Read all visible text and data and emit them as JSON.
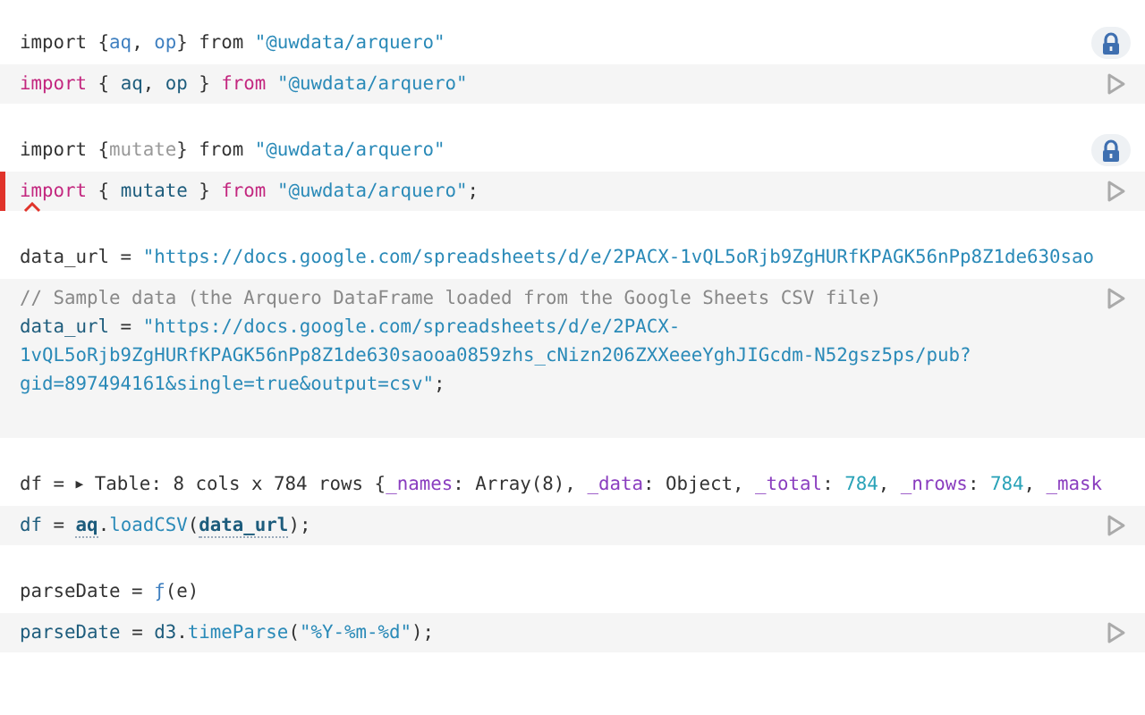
{
  "cells": [
    {
      "locked": true,
      "output": [
        {
          "text": "import {",
          "kind": "plain"
        },
        {
          "text": "aq",
          "kind": "name"
        },
        {
          "text": ", ",
          "kind": "plain"
        },
        {
          "text": "op",
          "kind": "name"
        },
        {
          "text": "} from ",
          "kind": "plain"
        },
        {
          "text": "\"@uwdata/arquero\"",
          "kind": "string"
        }
      ],
      "editor": {
        "error": false,
        "lines": [
          [
            {
              "text": "import",
              "kind": "keyword"
            },
            {
              "text": " { ",
              "kind": "plain"
            },
            {
              "text": "aq",
              "kind": "var"
            },
            {
              "text": ", ",
              "kind": "plain"
            },
            {
              "text": "op",
              "kind": "var"
            },
            {
              "text": " } ",
              "kind": "plain"
            },
            {
              "text": "from",
              "kind": "keyword"
            },
            {
              "text": " \"@uwdata/arquero\"",
              "kind": "string"
            }
          ]
        ]
      }
    },
    {
      "locked": true,
      "output": [
        {
          "text": "import {",
          "kind": "plain"
        },
        {
          "text": "mutate",
          "kind": "muted"
        },
        {
          "text": "} from ",
          "kind": "plain"
        },
        {
          "text": "\"@uwdata/arquero\"",
          "kind": "string"
        }
      ],
      "editor": {
        "error": true,
        "lines": [
          [
            {
              "text": "import",
              "kind": "keyword"
            },
            {
              "text": " { ",
              "kind": "plain"
            },
            {
              "text": "mutate",
              "kind": "var"
            },
            {
              "text": " } ",
              "kind": "plain"
            },
            {
              "text": "from",
              "kind": "keyword"
            },
            {
              "text": " \"@uwdata/arquero\"",
              "kind": "string"
            },
            {
              "text": ";",
              "kind": "plain"
            }
          ]
        ]
      }
    },
    {
      "locked": false,
      "output": [
        {
          "text": "data_url = ",
          "kind": "plain"
        },
        {
          "text": "\"https://docs.google.com/spreadsheets/d/e/2PACX-1vQL5oRjb9ZgHURfKPAGK56nPp8Z1de630sao",
          "kind": "string"
        }
      ],
      "editor": {
        "error": false,
        "lines": [
          [
            {
              "text": "// Sample data (the Arquero DataFrame loaded from the Google Sheets CSV file)",
              "kind": "comment"
            }
          ],
          [
            {
              "text": "data_url",
              "kind": "var"
            },
            {
              "text": " = ",
              "kind": "plain"
            },
            {
              "text": "\"https://docs.google.com/spreadsheets/d/e/2PACX-",
              "kind": "string"
            }
          ],
          [
            {
              "text": "1vQL5oRjb9ZgHURfKPAGK56nPp8Z1de630saooa0859zhs_cNizn206ZXXeeeYghJIGcdm-N52gsz5ps/pub?",
              "kind": "string"
            }
          ],
          [
            {
              "text": "gid=897494161&single=true&output=csv\"",
              "kind": "string"
            },
            {
              "text": ";",
              "kind": "plain"
            }
          ]
        ]
      }
    },
    {
      "locked": false,
      "output": [
        {
          "text": "df = ",
          "kind": "plain"
        },
        {
          "text": "▶",
          "kind": "toggle"
        },
        {
          "text": " Table: 8 cols x 784 rows {",
          "kind": "plain"
        },
        {
          "text": "_names",
          "kind": "prop"
        },
        {
          "text": ": Array(8), ",
          "kind": "plain"
        },
        {
          "text": "_data",
          "kind": "prop"
        },
        {
          "text": ": Object, ",
          "kind": "plain"
        },
        {
          "text": "_total",
          "kind": "prop"
        },
        {
          "text": ": ",
          "kind": "plain"
        },
        {
          "text": "784",
          "kind": "number"
        },
        {
          "text": ", ",
          "kind": "plain"
        },
        {
          "text": "_nrows",
          "kind": "prop"
        },
        {
          "text": ": ",
          "kind": "plain"
        },
        {
          "text": "784",
          "kind": "number"
        },
        {
          "text": ", ",
          "kind": "plain"
        },
        {
          "text": "_mask",
          "kind": "prop"
        }
      ],
      "editor": {
        "error": false,
        "lines": [
          [
            {
              "text": "df",
              "kind": "var"
            },
            {
              "text": " = ",
              "kind": "plain"
            },
            {
              "text": "aq",
              "kind": "ref"
            },
            {
              "text": ".",
              "kind": "plain"
            },
            {
              "text": "loadCSV",
              "kind": "method"
            },
            {
              "text": "(",
              "kind": "plain"
            },
            {
              "text": "data_url",
              "kind": "ref"
            },
            {
              "text": ");",
              "kind": "plain"
            }
          ]
        ]
      }
    },
    {
      "locked": false,
      "output": [
        {
          "text": "parseDate = ",
          "kind": "plain"
        },
        {
          "text": "ƒ",
          "kind": "name"
        },
        {
          "text": "(e)",
          "kind": "plain"
        }
      ],
      "editor": {
        "error": false,
        "lines": [
          [
            {
              "text": "parseDate",
              "kind": "var"
            },
            {
              "text": " = ",
              "kind": "plain"
            },
            {
              "text": "d3",
              "kind": "var"
            },
            {
              "text": ".",
              "kind": "plain"
            },
            {
              "text": "timeParse",
              "kind": "method"
            },
            {
              "text": "(",
              "kind": "plain"
            },
            {
              "text": "\"%Y-%m-%d\"",
              "kind": "string"
            },
            {
              "text": ");",
              "kind": "plain"
            }
          ]
        ]
      }
    }
  ]
}
